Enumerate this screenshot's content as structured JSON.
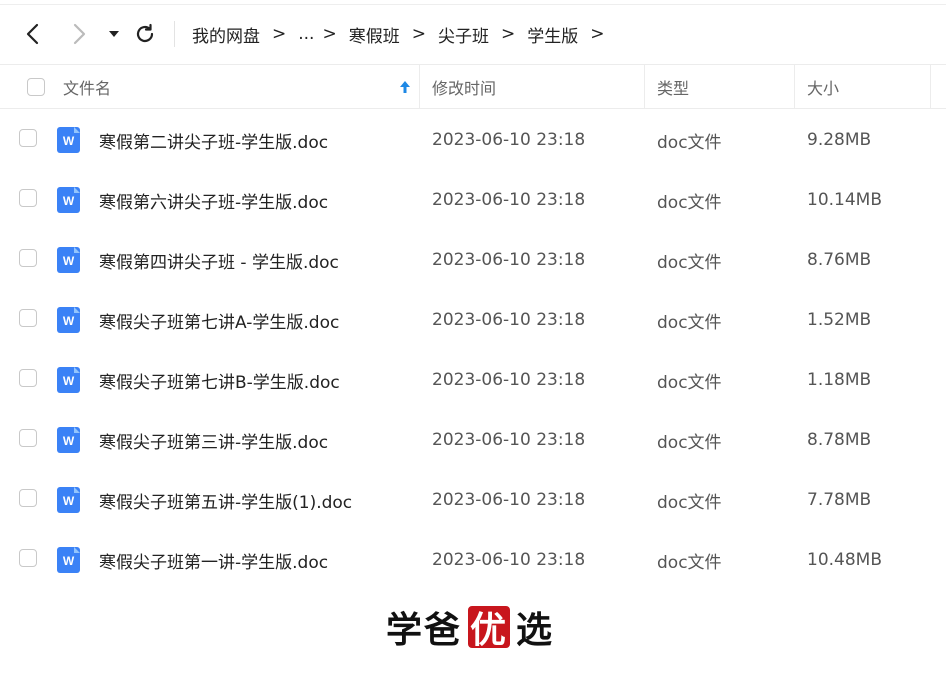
{
  "toolbar": {
    "back_icon": "chevron-left-icon",
    "forward_icon": "chevron-right-icon",
    "history_icon": "caret-down-icon",
    "refresh_icon": "refresh-icon"
  },
  "breadcrumb": {
    "items": [
      "我的网盘",
      "...",
      "寒假班",
      "尖子班",
      "学生版"
    ],
    "separator": ">"
  },
  "columns": {
    "name": "文件名",
    "modified": "修改时间",
    "type": "类型",
    "size": "大小",
    "sort_icon": "arrow-up-icon"
  },
  "files": [
    {
      "name": "寒假第二讲尖子班-学生版.doc",
      "modified": "2023-06-10 23:18",
      "type": "doc文件",
      "size": "9.28MB"
    },
    {
      "name": "寒假第六讲尖子班-学生版.doc",
      "modified": "2023-06-10 23:18",
      "type": "doc文件",
      "size": "10.14MB"
    },
    {
      "name": "寒假第四讲尖子班 - 学生版.doc",
      "modified": "2023-06-10 23:18",
      "type": "doc文件",
      "size": "8.76MB"
    },
    {
      "name": "寒假尖子班第七讲A-学生版.doc",
      "modified": "2023-06-10 23:18",
      "type": "doc文件",
      "size": "1.52MB"
    },
    {
      "name": "寒假尖子班第七讲B-学生版.doc",
      "modified": "2023-06-10 23:18",
      "type": "doc文件",
      "size": "1.18MB"
    },
    {
      "name": "寒假尖子班第三讲-学生版.doc",
      "modified": "2023-06-10 23:18",
      "type": "doc文件",
      "size": "8.78MB"
    },
    {
      "name": "寒假尖子班第五讲-学生版(1).doc",
      "modified": "2023-06-10 23:18",
      "type": "doc文件",
      "size": "7.78MB"
    },
    {
      "name": "寒假尖子班第一讲-学生版.doc",
      "modified": "2023-06-10 23:18",
      "type": "doc文件",
      "size": "10.48MB"
    }
  ],
  "file_icon": "word-doc-icon",
  "colors": {
    "word_icon": "#3b82f6",
    "sort_arrow": "#1e88e5",
    "seal": "#c8161d"
  },
  "watermark": {
    "part1": "学爸",
    "seal": "优",
    "part2": "选"
  }
}
